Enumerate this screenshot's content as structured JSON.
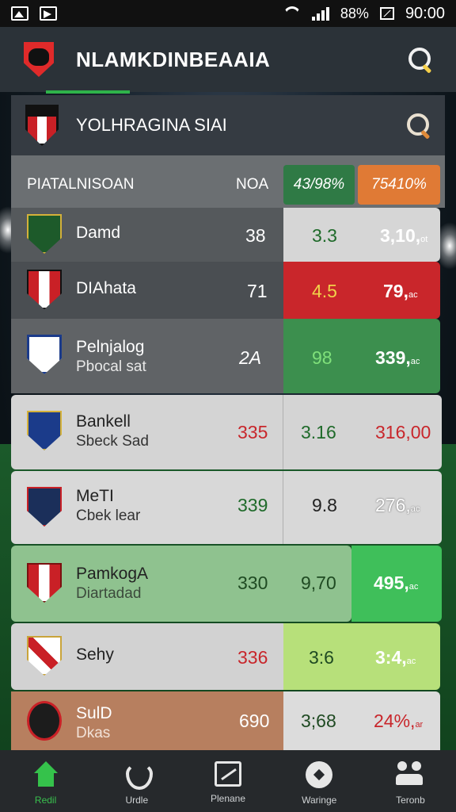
{
  "status_bar": {
    "time": "90:00",
    "battery_text": "88%"
  },
  "header": {
    "title": "NLAMKDINBEAAIA"
  },
  "search": {
    "text": "YOLHRAGINA SIAI"
  },
  "table": {
    "headers": {
      "team": "PIATALNISOAN",
      "col_a": "NOA",
      "col_b": "43/98%",
      "col_c": "75410%"
    },
    "rows": [
      {
        "name": "Damd",
        "sub": "",
        "a": "38",
        "b": "3.3",
        "c": "3,10,",
        "c_small": "ot"
      },
      {
        "name": "DIAhata",
        "sub": "",
        "a": "71",
        "b": "4.5",
        "c": "79,",
        "c_small": "ac"
      },
      {
        "name": "Pelnjalog",
        "sub": "Pbocal sat",
        "a": "2A",
        "b": "98",
        "c": "339,",
        "c_small": "ac"
      },
      {
        "name": "Bankell",
        "sub": "Sbeck Sad",
        "a": "335",
        "b": "3.16",
        "c": "316,00",
        "c_small": ""
      },
      {
        "name": "MeTI",
        "sub": "Cbek lear",
        "a": "339",
        "b": "9.8",
        "c": "276,",
        "c_small": "ac"
      },
      {
        "name": "PamkogA",
        "sub": "Diartadad",
        "a": "330",
        "b": "9,70",
        "c": "495,",
        "c_small": "ac"
      },
      {
        "name": "Sehy",
        "sub": "",
        "a": "336",
        "b": "3:6",
        "c": "3:4,",
        "c_small": "ac"
      },
      {
        "name": "SulD",
        "sub": "Dkas",
        "a": "690",
        "b": "3;68",
        "c": "24%,",
        "c_small": "ar"
      }
    ]
  },
  "nav": [
    {
      "label": "Redil",
      "icon": "home-icon"
    },
    {
      "label": "Urdle",
      "icon": "heart-icon"
    },
    {
      "label": "Plenane",
      "icon": "chart-icon"
    },
    {
      "label": "Waringe",
      "icon": "compass-icon"
    },
    {
      "label": "Teronb",
      "icon": "people-icon"
    }
  ],
  "colors": {
    "accent_green": "#2fb34a",
    "header_b": "#2f7a45",
    "header_c": "#e07a35",
    "red_value": "#c8262b",
    "green_value": "#1f6a2a"
  }
}
